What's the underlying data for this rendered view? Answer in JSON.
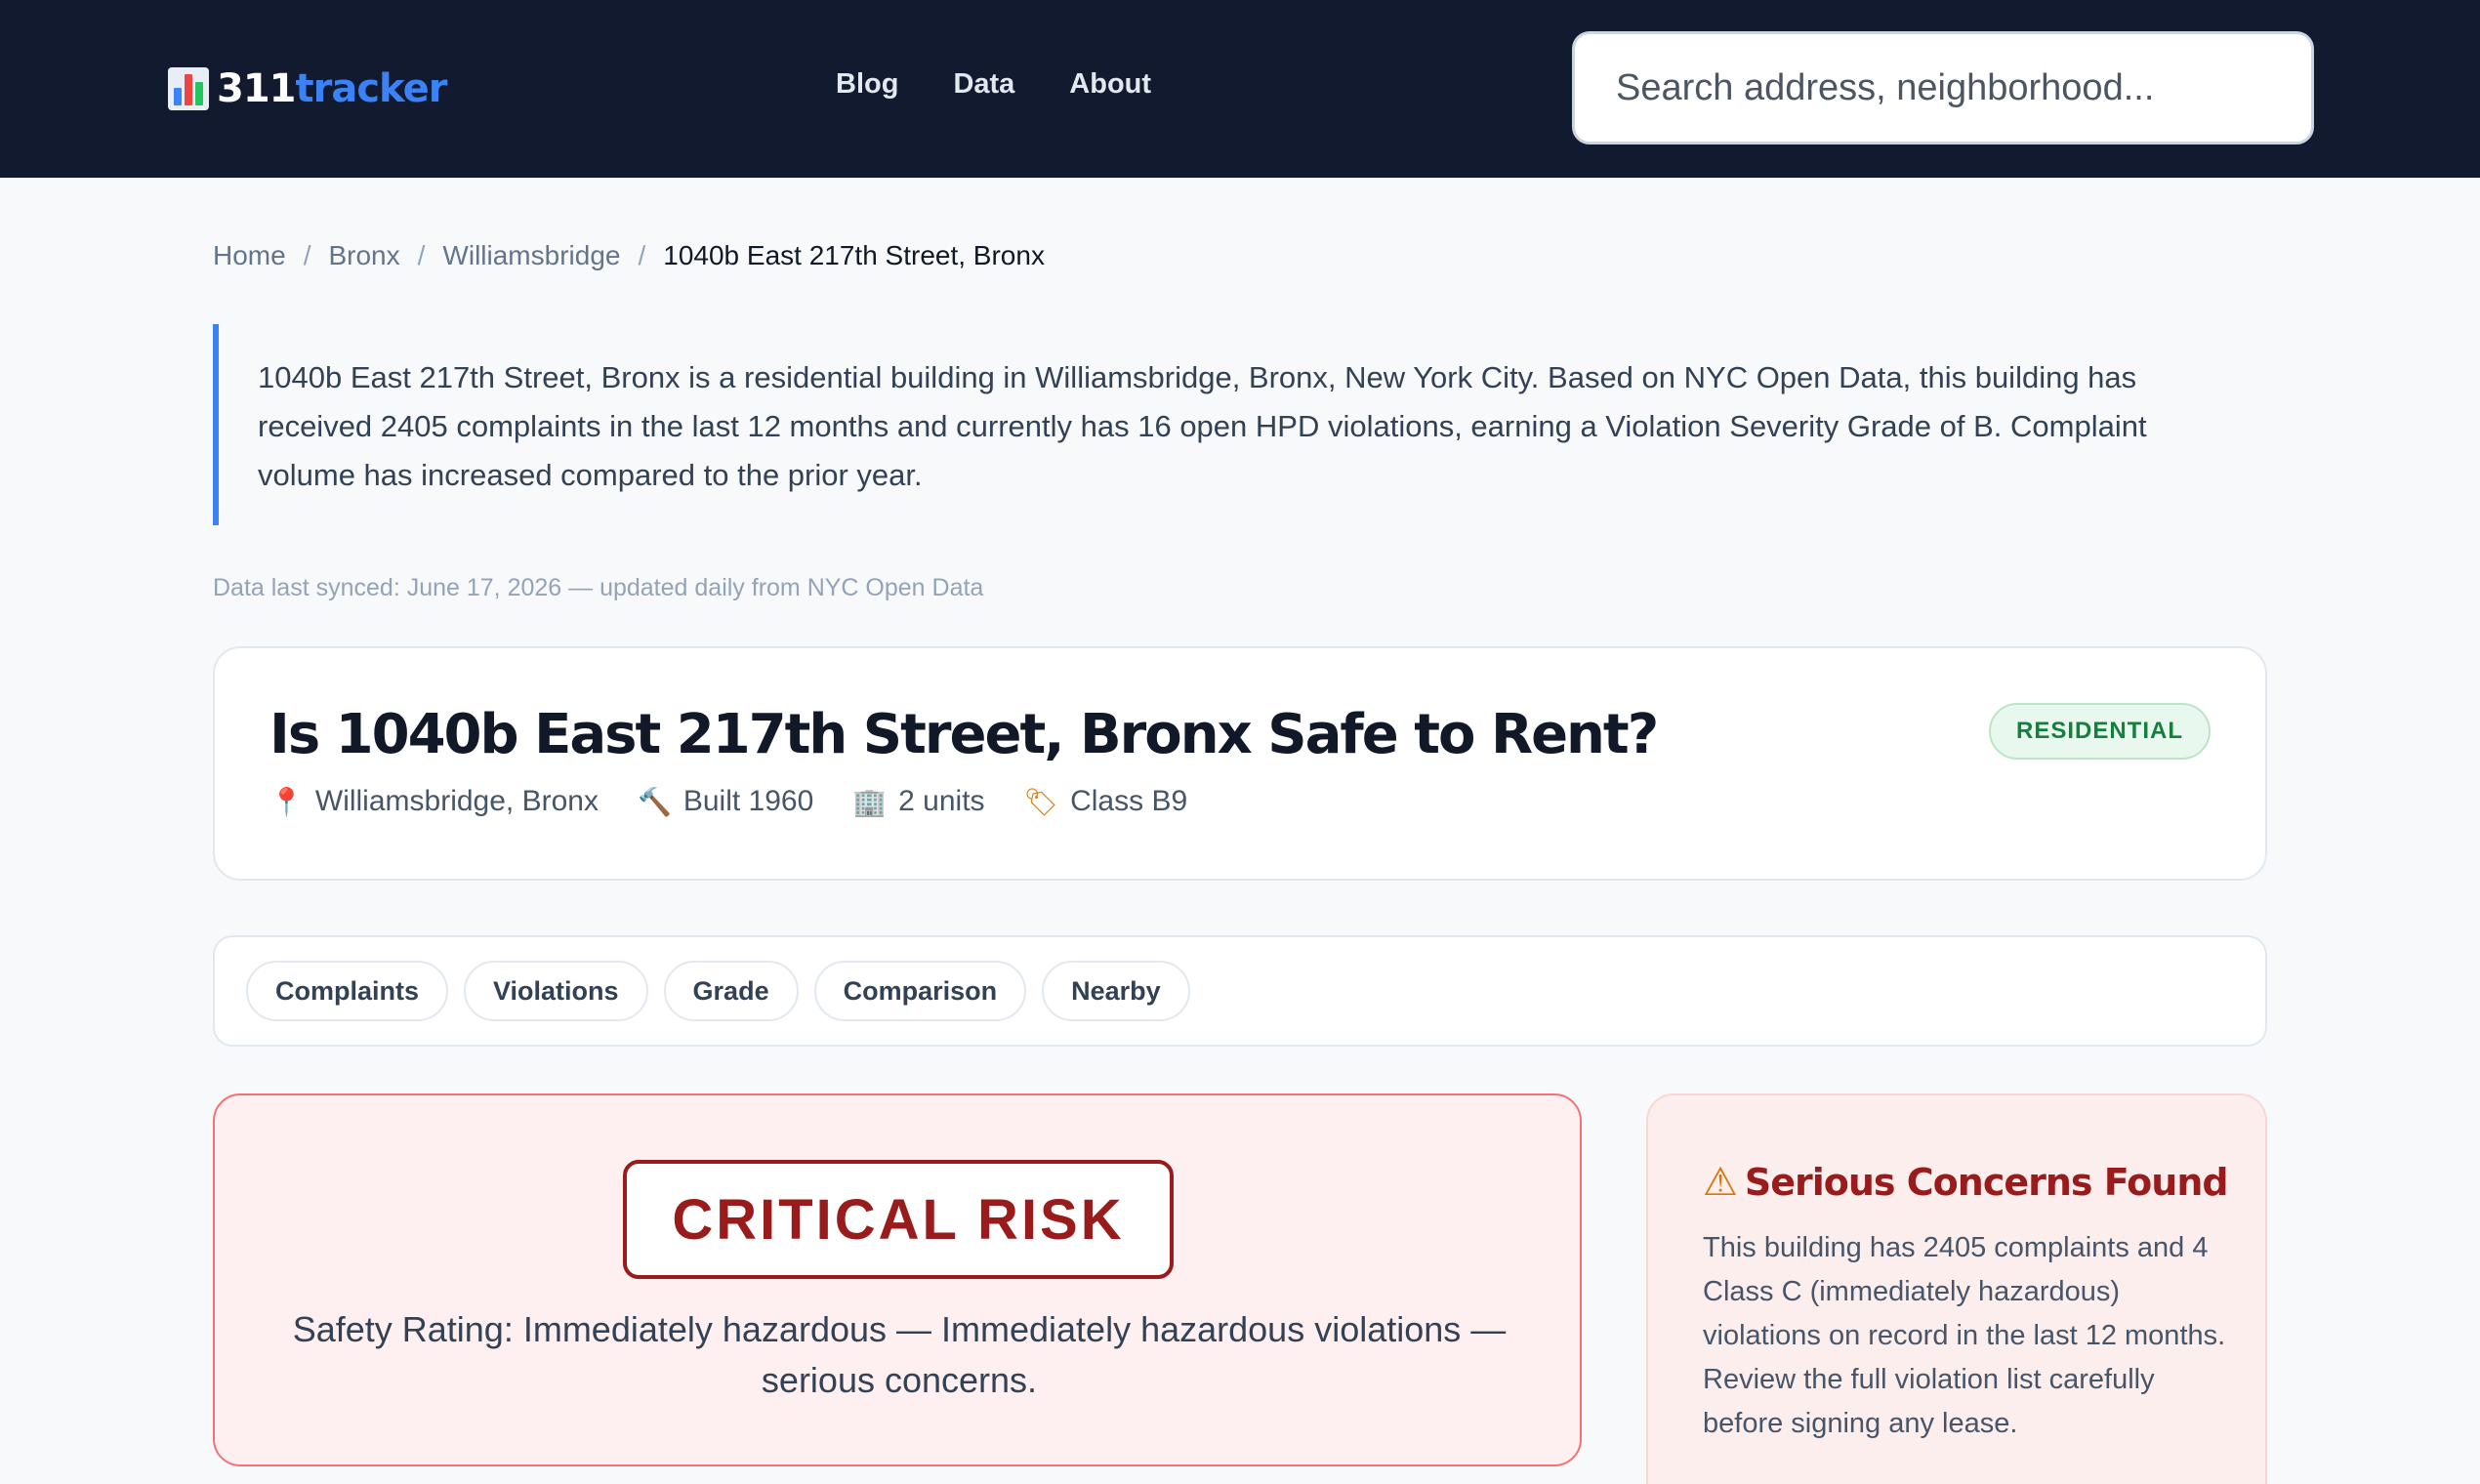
{
  "header": {
    "logo_number": "311",
    "logo_word": "tracker",
    "logo_icon": "bar-chart-icon",
    "nav": [
      "Blog",
      "Data",
      "About"
    ],
    "search_placeholder": "Search address, neighborhood..."
  },
  "breadcrumb": {
    "items": [
      "Home",
      "Bronx",
      "Williamsbridge"
    ],
    "current": "1040b East 217th Street, Bronx",
    "separator": "/"
  },
  "intro": "1040b East 217th Street, Bronx is a residential building in Williamsbridge, Bronx, New York City. Based on NYC Open Data, this building has received 2405 complaints in the last 12 months and currently has 16 open HPD violations, earning a Violation Severity Grade of B. Complaint volume has increased compared to the prior year.",
  "synced": "Data last synced: June 17, 2026 — updated daily from NYC Open Data",
  "property": {
    "title": "Is 1040b East 217th Street, Bronx Safe to Rent?",
    "badge": "RESIDENTIAL",
    "meta": [
      {
        "icon": "location-pin-icon",
        "glyph": "📍",
        "text": "Williamsbridge, Bronx"
      },
      {
        "icon": "hammer-icon",
        "glyph": "🔨",
        "text": "Built 1960"
      },
      {
        "icon": "building-icon",
        "glyph": "🏢",
        "text": "2 units"
      },
      {
        "icon": "tag-icon",
        "glyph": "🏷",
        "text": "Class B9"
      }
    ]
  },
  "tabs": [
    "Complaints",
    "Violations",
    "Grade",
    "Comparison",
    "Nearby"
  ],
  "risk": {
    "label": "CRITICAL RISK",
    "text": "Safety Rating: Immediately hazardous — Immediately hazardous violations — serious concerns."
  },
  "concerns": {
    "icon": "warning-icon",
    "glyph": "⚠",
    "title": "Serious Concerns Found",
    "text": "This building has 2405 complaints and 4 Class C (immediately hazardous) violations on record in the last 12 months. Review the full violation list carefully before signing any lease."
  },
  "colors": {
    "header_bg": "#111a2e",
    "accent": "#3b82f6",
    "danger": "#991b1b",
    "success": "#15803d"
  }
}
